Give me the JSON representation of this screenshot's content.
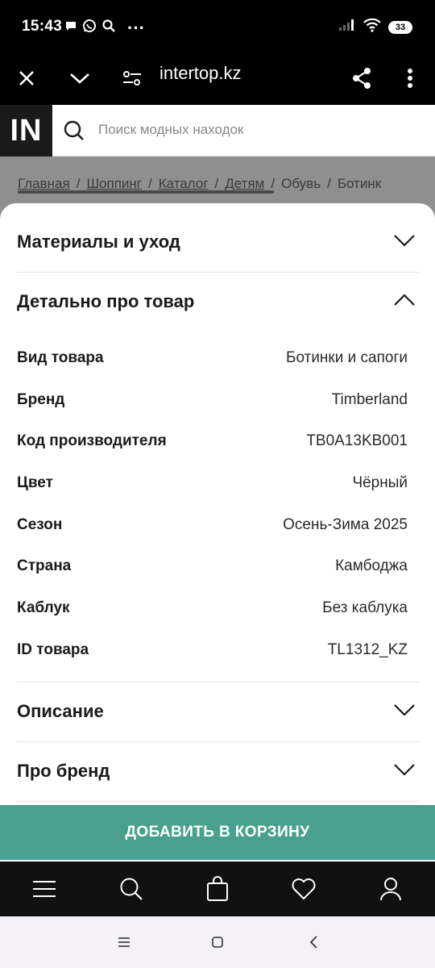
{
  "status_bar": {
    "time": "15:43",
    "dots": "···",
    "battery": "33"
  },
  "browser": {
    "url": "intertop.kz"
  },
  "site": {
    "logo": "IN",
    "search_placeholder": "Поиск модных находок"
  },
  "breadcrumb": [
    "Главная",
    "Шоппинг",
    "Каталог",
    "Детям",
    "Обувь",
    "Ботинк"
  ],
  "breadcrumb_sep": "/",
  "sections": {
    "materials": "Материалы и уход",
    "details": "Детально про товар",
    "description": "Описание",
    "brand": "Про бренд"
  },
  "details": [
    {
      "label": "Вид товара",
      "value": "Ботинки и сапоги"
    },
    {
      "label": "Бренд",
      "value": "Timberland"
    },
    {
      "label": "Код производителя",
      "value": "TB0A13KB001"
    },
    {
      "label": "Цвет",
      "value": "Чёрный"
    },
    {
      "label": "Сезон",
      "value": "Осень-Зима 2025"
    },
    {
      "label": "Страна",
      "value": "Камбоджа"
    },
    {
      "label": "Каблук",
      "value": "Без каблука"
    },
    {
      "label": "ID товара",
      "value": "TL1312_KZ"
    }
  ],
  "cart_button": "ДОБАВИТЬ В КОРЗИНУ",
  "colors": {
    "accent": "#4aa08f",
    "dark": "#111111"
  }
}
